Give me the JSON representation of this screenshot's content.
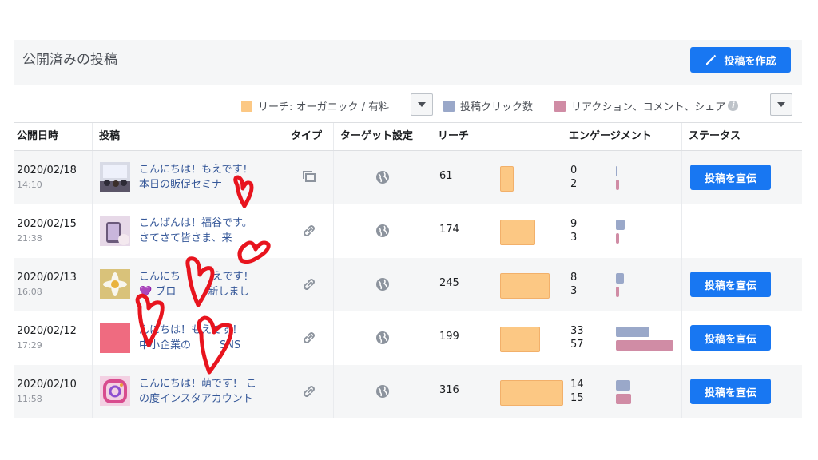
{
  "header": {
    "title": "公開済みの投稿",
    "create_button": "投稿を作成"
  },
  "legend": {
    "reach": "リーチ: オーガニック / 有料",
    "clicks": "投稿クリック数",
    "reactions": "リアクション、コメント、シェア",
    "info_icon": "i",
    "colors": {
      "reach": "#fcc884",
      "clicks": "#9aa8c9",
      "reactions": "#d08ca5"
    }
  },
  "columns": [
    "公開日時",
    "投稿",
    "タイプ",
    "ターゲット設定",
    "リーチ",
    "エンゲージメント",
    "ステータス"
  ],
  "rows": [
    {
      "date": "2020/02/18",
      "time": "14:10",
      "text1": "こんにちは！もえです！",
      "text2": "本日の販促セミナ",
      "type": "photo-icon",
      "reach": 61,
      "clicks": 0,
      "reactions": 2,
      "promote": "投稿を宣伝"
    },
    {
      "date": "2020/02/15",
      "time": "21:38",
      "text1": "こんばんは！福谷です。",
      "text2": "さてさて皆さま、来",
      "type": "link-icon",
      "reach": 174,
      "clicks": 9,
      "reactions": 3,
      "promote": ""
    },
    {
      "date": "2020/02/13",
      "time": "16:08",
      "text1": "こんにち",
      "text2": "💜 ブロ",
      "text1b": "えです！",
      "text2b": "新しまし",
      "type": "link-icon",
      "reach": 245,
      "clicks": 8,
      "reactions": 3,
      "promote": "投稿を宣伝"
    },
    {
      "date": "2020/02/12",
      "time": "17:29",
      "text1": "んにちは！も",
      "text2": "中小企業の",
      "text1b": "えです！",
      "text2b": "SNS",
      "type": "link-icon",
      "reach": 199,
      "clicks": 33,
      "reactions": 57,
      "promote": "投稿を宣伝"
    },
    {
      "date": "2020/02/10",
      "time": "11:58",
      "text1": "こんにちは！萌です！ こ",
      "text2": "の度インスタアカウント",
      "type": "link-icon",
      "reach": 316,
      "clicks": 14,
      "reactions": 15,
      "promote": "投稿を宣伝"
    }
  ]
}
